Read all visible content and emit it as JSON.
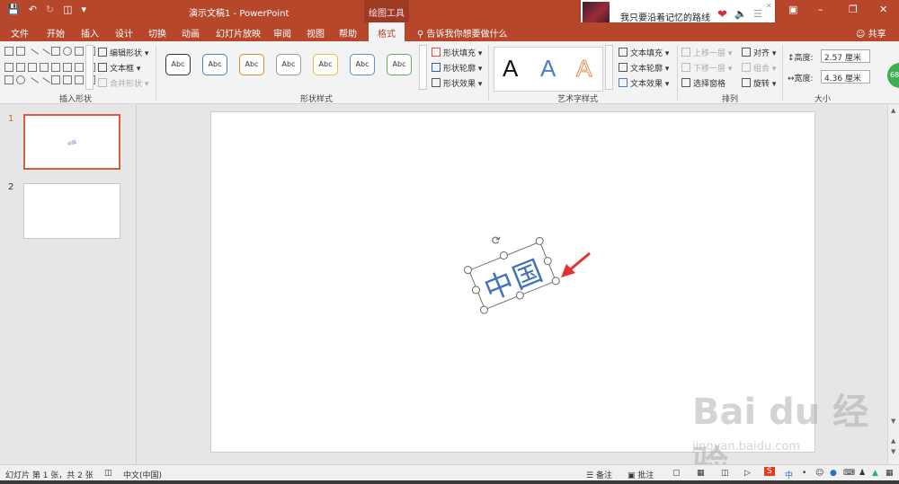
{
  "titlebar": {
    "qat_icons": [
      "save-icon",
      "undo-icon",
      "redo-icon",
      "custom-icon",
      "dropdown-icon"
    ],
    "doc_title": "演示文稿1 - PowerPoint",
    "context_group": "绘图工具",
    "music_song": "我只要沿着记忆的路线",
    "window_icons": [
      "ribbon-display-icon",
      "minimize-icon",
      "restore-icon",
      "close-icon"
    ]
  },
  "tabs": [
    "文件",
    "开始",
    "插入",
    "设计",
    "切换",
    "动画",
    "幻灯片放映",
    "审阅",
    "视图",
    "帮助",
    "格式"
  ],
  "active_tab": "格式",
  "tell_me": "告诉我你想要做什么",
  "share": "共享",
  "ribbon": {
    "insert_shapes": {
      "label": "插入形状",
      "edit_shape": "编辑形状",
      "text_box": "文本框",
      "merge_shapes": "合并形状"
    },
    "shape_styles": {
      "label": "形状样式",
      "gallery": [
        "Abc",
        "Abc",
        "Abc",
        "Abc",
        "Abc",
        "Abc",
        "Abc"
      ],
      "gallery_colors": [
        "#333333",
        "#4f7ec0",
        "#d08b3a",
        "#999999",
        "#e8c23a",
        "#5a8fc8",
        "#6aa56a"
      ],
      "fill": "形状填充",
      "outline": "形状轮廓",
      "effects": "形状效果"
    },
    "wordart": {
      "label": "艺术字样式",
      "letters": [
        "A",
        "A",
        "A"
      ],
      "letter_colors": [
        "#111111",
        "#4f7ec0",
        "#e78b52"
      ],
      "text_fill": "文本填充",
      "text_outline": "文本轮廓",
      "text_effects": "文本效果"
    },
    "arrange": {
      "label": "排列",
      "bring_forward": "上移一层",
      "send_backward": "下移一层",
      "selection_pane": "选择窗格",
      "align": "对齐",
      "group": "组合",
      "rotate": "旋转"
    },
    "size": {
      "label": "大小",
      "height_label": "高度:",
      "height_value": "2.57 厘米",
      "width_label": "宽度:",
      "width_value": "4.36 厘米"
    }
  },
  "badge_number": "68",
  "slides": [
    {
      "num": "1",
      "selected": true,
      "mini_text": "中国"
    },
    {
      "num": "2",
      "selected": false
    }
  ],
  "textbox": {
    "text": "中国",
    "color": "#3f72b7"
  },
  "annotation_color": "#e5322d",
  "status": {
    "slide_info": "幻灯片 第 1 张，共 2 张",
    "language": "中文(中国)",
    "notes": "备注",
    "comments": "批注"
  },
  "tray_text": [
    "中"
  ],
  "watermark": {
    "big": "Bai du 经验",
    "small": "jingyan.baidu.com"
  }
}
